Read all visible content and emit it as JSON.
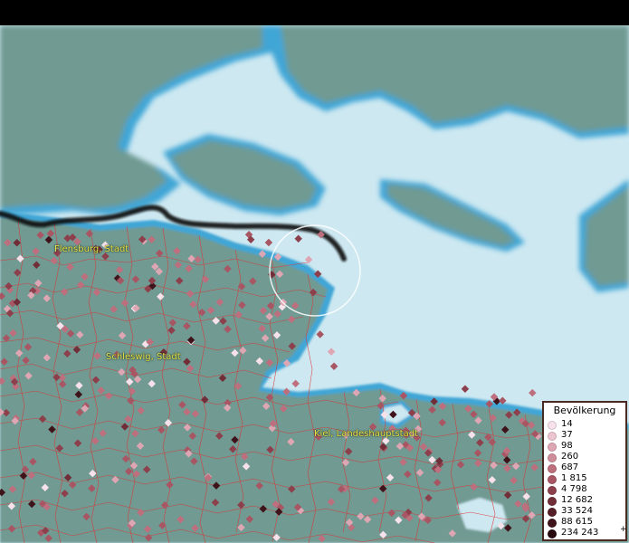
{
  "map": {
    "land_color": "#6f9a92",
    "water_color": "#cde8f1",
    "coast_color": "#3fa6d6",
    "boundary_color": "#e23030",
    "border_color": "#111111",
    "cities": [
      {
        "name": "Flensburg, Stadt"
      },
      {
        "name": "Schleswig, Stadt"
      },
      {
        "name": "Kiel, Landeshauptstadt"
      }
    ]
  },
  "legend": {
    "title": "Bevölkerung",
    "plus": "+",
    "entries": [
      {
        "label": "14",
        "color": "#f7e1ea"
      },
      {
        "label": "37",
        "color": "#edc5d0"
      },
      {
        "label": "98",
        "color": "#dea6b3"
      },
      {
        "label": "260",
        "color": "#cf8c99"
      },
      {
        "label": "687",
        "color": "#bd6f7e"
      },
      {
        "label": "1 815",
        "color": "#a85663"
      },
      {
        "label": "4 798",
        "color": "#8d3f4c"
      },
      {
        "label": "12 682",
        "color": "#712e38"
      },
      {
        "label": "33 524",
        "color": "#561f27"
      },
      {
        "label": "88 615",
        "color": "#3e131a"
      },
      {
        "label": "234 243",
        "color": "#26080d"
      }
    ]
  }
}
